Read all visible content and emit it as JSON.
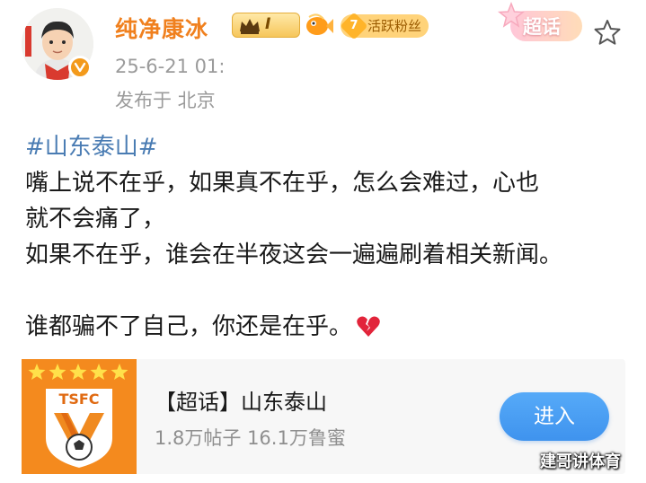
{
  "user": {
    "name": "纯净康冰",
    "level": "I",
    "fan_level": "7",
    "fan_badge": "活跃粉丝",
    "verified_color": "#f39a1b"
  },
  "chaohua_tag": "超话",
  "meta": {
    "timestamp": "25-6-21 01:",
    "location": "发布于 北京"
  },
  "post": {
    "hashtag": "#山东泰山#",
    "lines": [
      "嘴上说不在乎，如果真不在乎，怎么会难过，心也",
      "就不会痛了，",
      "如果不在乎，谁会在半夜这会一遍遍刷着相关新闻。",
      "",
      "谁都骗不了自己，你还是在乎。"
    ],
    "emoji": "broken-heart-icon"
  },
  "card": {
    "logo_text": "TSFC",
    "logo_stars": 5,
    "title": "【超话】山东泰山",
    "stats": "1.8万帖子 16.1万鲁蜜",
    "join_label": "进入"
  },
  "watermark": "建哥讲体育",
  "colors": {
    "username": "#f0801e",
    "hashtag": "#4a7cb3",
    "join_button": "#4a9ef4",
    "logo_bg": "#f48a1e"
  }
}
